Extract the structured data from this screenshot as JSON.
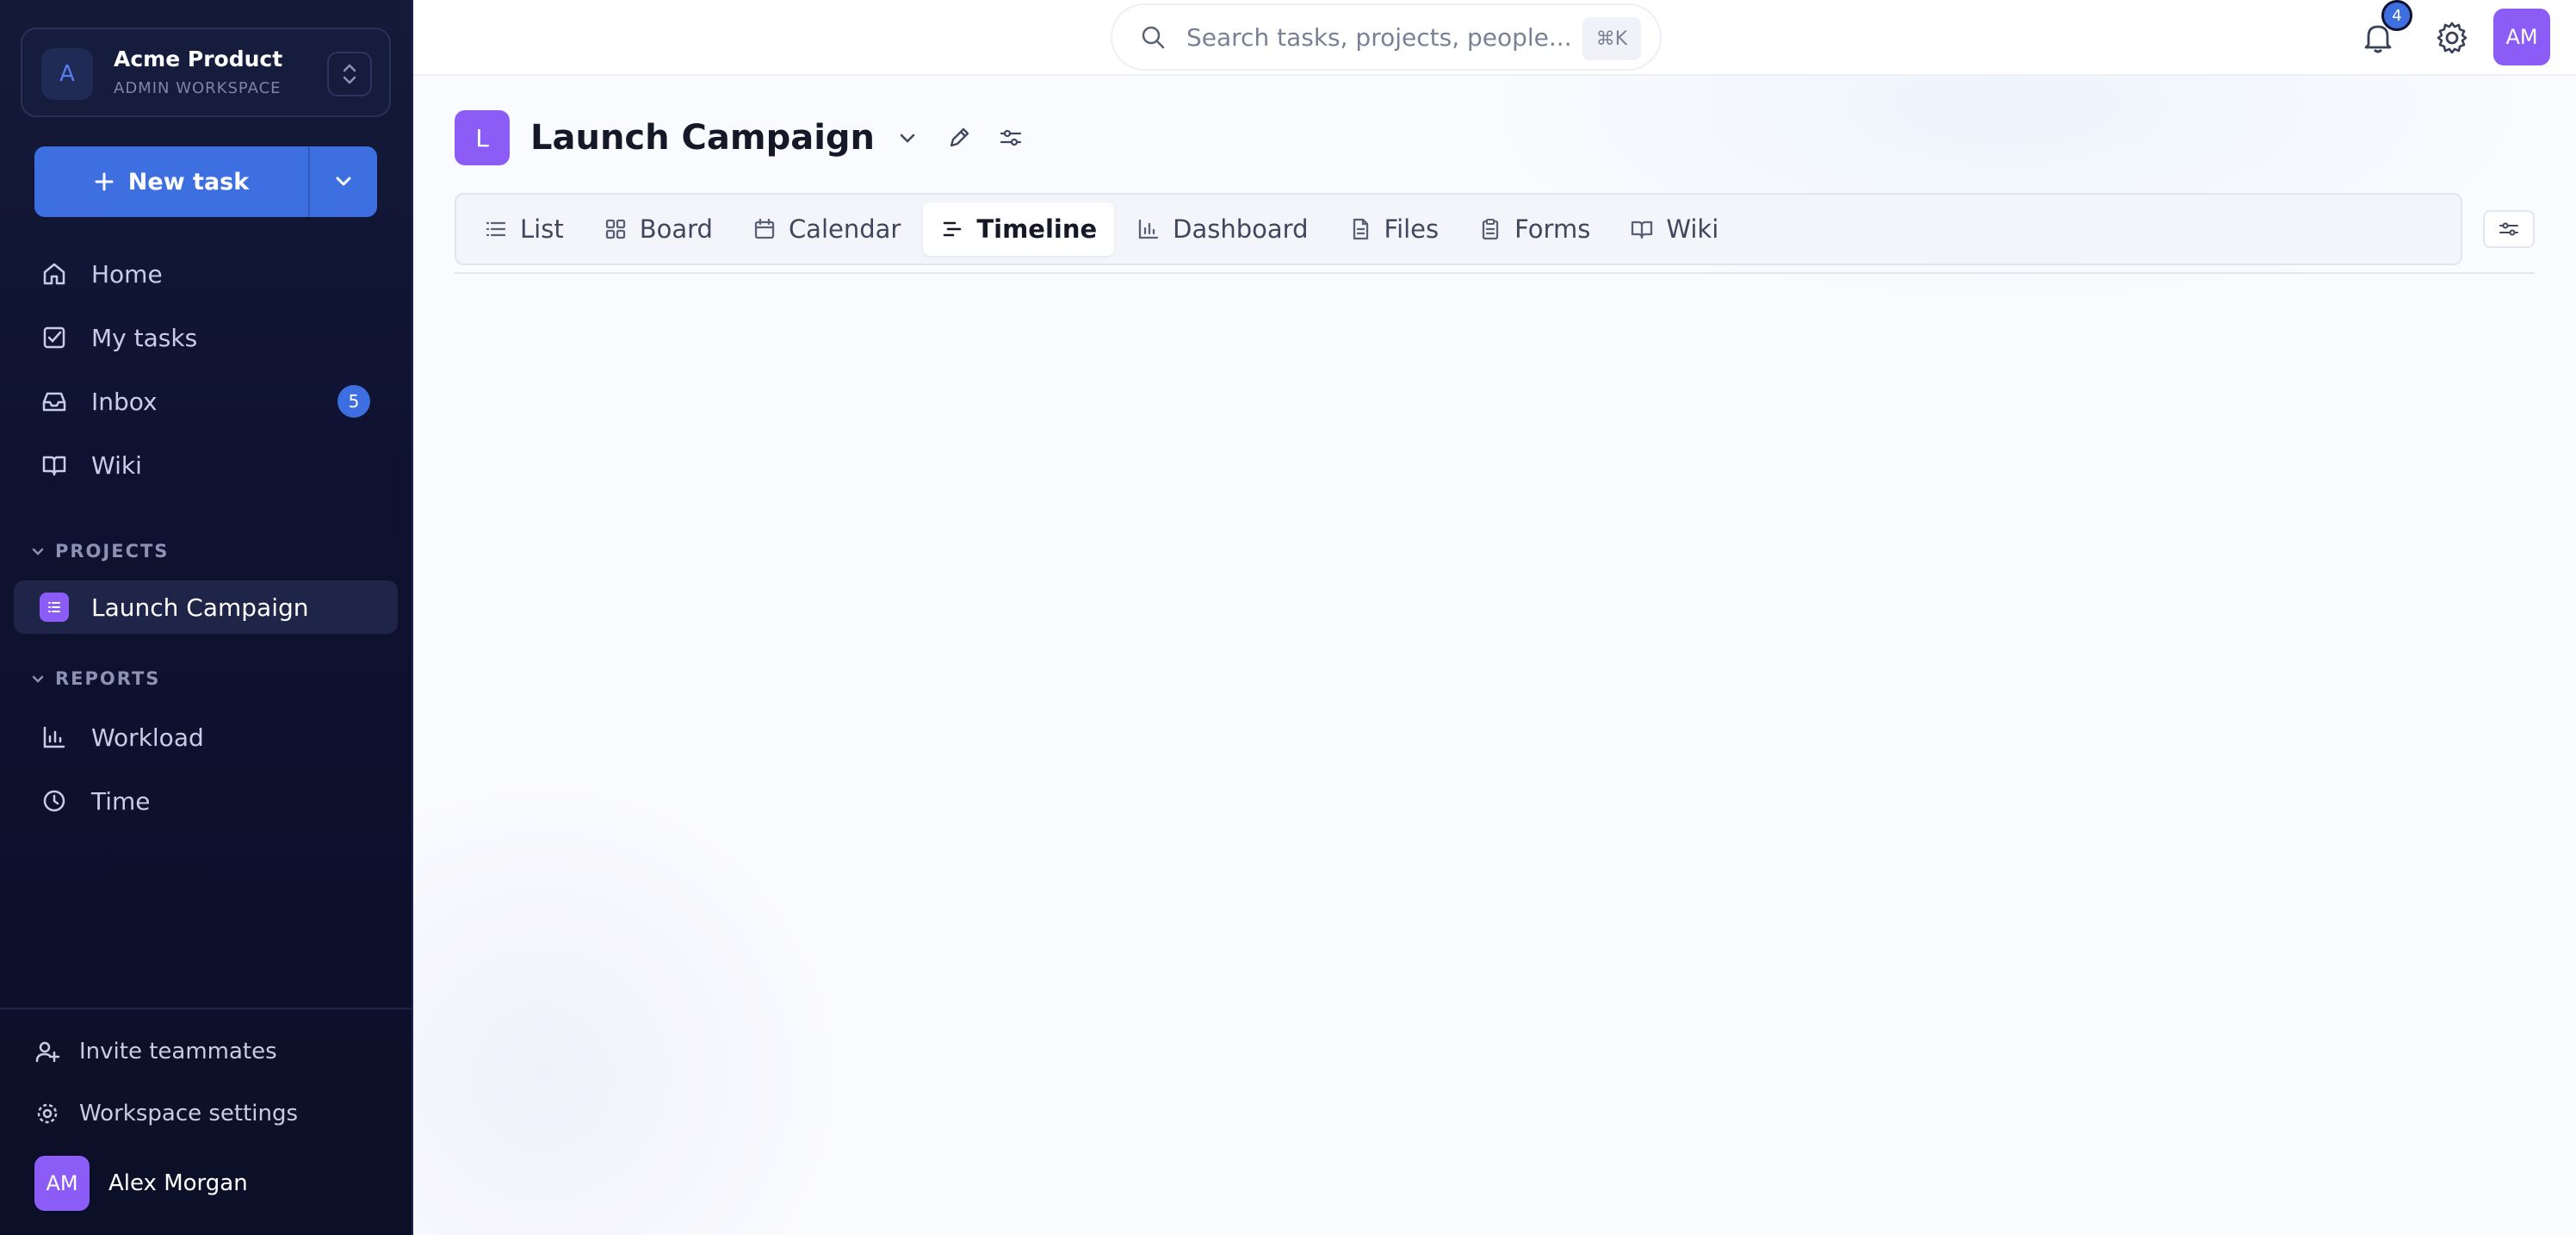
{
  "workspace": {
    "avatar": "A",
    "name": "Acme Product",
    "subtitle": "ADMIN WORKSPACE"
  },
  "new_task": {
    "label": "New task"
  },
  "nav": [
    {
      "label": "Home",
      "icon": "home-icon"
    },
    {
      "label": "My tasks",
      "icon": "check-square-icon"
    },
    {
      "label": "Inbox",
      "icon": "inbox-icon",
      "badge": "5"
    },
    {
      "label": "Wiki",
      "icon": "book-icon"
    }
  ],
  "projects": {
    "heading": "PROJECTS",
    "items": [
      {
        "label": "Launch Campaign",
        "active": true
      }
    ]
  },
  "reports": {
    "heading": "REPORTS",
    "items": [
      {
        "label": "Workload",
        "icon": "bar-chart-icon"
      },
      {
        "label": "Time",
        "icon": "clock-icon"
      }
    ]
  },
  "footer": {
    "invite": "Invite teammates",
    "settings": "Workspace settings",
    "user_initials": "AM",
    "user_name": "Alex Morgan"
  },
  "topbar": {
    "search_placeholder": "Search tasks, projects, people...",
    "shortcut": "⌘K",
    "notifications": "4",
    "avatar": "AM"
  },
  "project": {
    "logo": "L",
    "title": "Launch Campaign"
  },
  "tabs": [
    {
      "label": "List",
      "icon": "list-icon"
    },
    {
      "label": "Board",
      "icon": "grid-icon"
    },
    {
      "label": "Calendar",
      "icon": "calendar-icon"
    },
    {
      "label": "Timeline",
      "icon": "timeline-icon",
      "active": true
    },
    {
      "label": "Dashboard",
      "icon": "bar-chart-icon"
    },
    {
      "label": "Files",
      "icon": "file-icon"
    },
    {
      "label": "Forms",
      "icon": "clipboard-icon"
    },
    {
      "label": "Wiki",
      "icon": "book-icon"
    }
  ],
  "colors": {
    "accent": "#3e6fe0",
    "purple": "#8b5cf6",
    "sidebar": "#0e1230"
  }
}
